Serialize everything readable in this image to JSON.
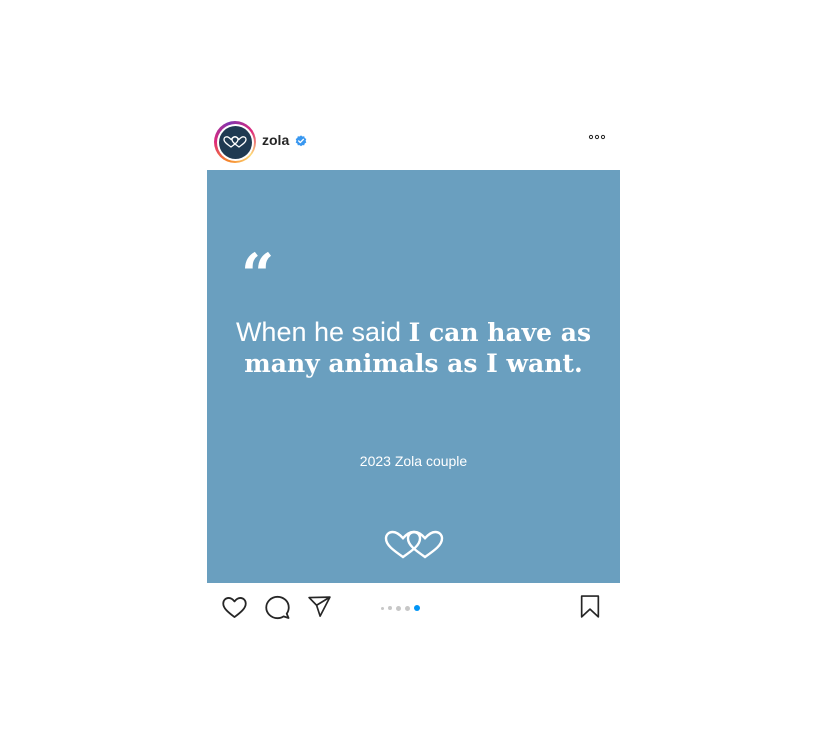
{
  "account": {
    "username": "zola",
    "verified_icon": "verified-badge-icon",
    "verified_color": "#3897f0",
    "avatar_bg": "#1f3a52"
  },
  "post": {
    "bg_color": "#6a9fbf",
    "quote_mark": "“",
    "quote_lead": "When he said ",
    "quote_bold": "I can have as many animals as I want.",
    "attribution": "2023 Zola couple",
    "logo_icon": "zola-hearts-logo-icon"
  },
  "carousel": {
    "count": 5,
    "active_index": 4,
    "active_color": "#0095f6"
  },
  "actions": {
    "like_icon": "heart-icon",
    "comment_icon": "comment-icon",
    "share_icon": "send-icon",
    "save_icon": "bookmark-icon",
    "more_icon": "more-options-icon"
  }
}
